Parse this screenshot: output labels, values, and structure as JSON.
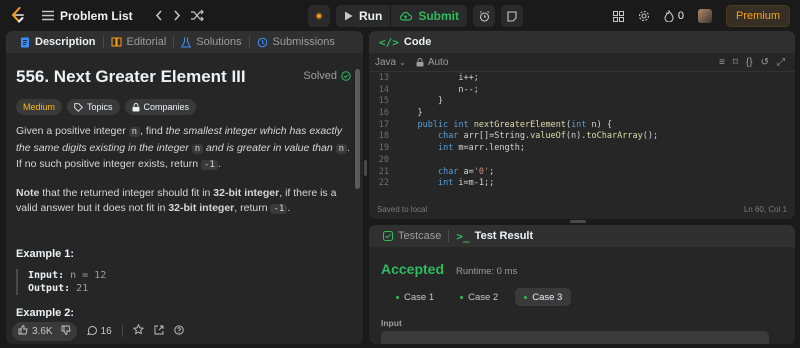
{
  "topbar": {
    "problem_list_label": "Problem List",
    "run_label": "Run",
    "submit_label": "Submit",
    "streak_count": "0",
    "premium_label": "Premium"
  },
  "left": {
    "tabs": [
      {
        "label": "Description"
      },
      {
        "label": "Editorial"
      },
      {
        "label": "Solutions"
      },
      {
        "label": "Submissions"
      }
    ],
    "title": "556. Next Greater Element III",
    "status": "Solved",
    "badges": {
      "difficulty": "Medium",
      "topics": "Topics",
      "companies": "Companies"
    },
    "para1": {
      "a": "Given a positive integer ",
      "code1": "n",
      "b": ", find ",
      "c": "the smallest integer which has exactly the same digits existing in the integer ",
      "code2": "n",
      "d": " and is greater in value than ",
      "code3": "n",
      "e": ". If no such positive integer exists, return ",
      "code4": "-1",
      "f": "."
    },
    "para2": {
      "a": "Note",
      "b": " that the returned integer should fit in ",
      "c": "32-bit integer",
      "d": ", if there is a valid answer but it does not fit in ",
      "e": "32-bit integer",
      "f": ", return ",
      "code": "-1",
      "g": "."
    },
    "example1": {
      "title": "Example 1:",
      "input_label": "Input:",
      "input_value": " n = 12",
      "output_label": "Output:",
      "output_value": " 21"
    },
    "example2_title": "Example 2:",
    "footer": {
      "likes": "3.6K",
      "comments": "16"
    }
  },
  "code": {
    "header_label": "Code",
    "language": "Java",
    "mode": "Auto",
    "lines": [
      {
        "n": "13",
        "t": "            i++;"
      },
      {
        "n": "14",
        "t": "            n--;"
      },
      {
        "n": "15",
        "t": "        }"
      },
      {
        "n": "16",
        "t": "    }"
      },
      {
        "n": "17",
        "t": "    public int nextGreaterElement(int n) {"
      },
      {
        "n": "18",
        "t": "        char arr[]=String.valueOf(n).toCharArray();"
      },
      {
        "n": "19",
        "t": "        int m=arr.length;"
      },
      {
        "n": "20",
        "t": ""
      },
      {
        "n": "21",
        "t": "        char a='0';"
      },
      {
        "n": "22",
        "t": "        int i=m-1;;"
      }
    ],
    "saved_text": "Saved to local",
    "cursor_text": "Ln 60, Col 1"
  },
  "test": {
    "tab_testcase": "Testcase",
    "tab_result": "Test Result",
    "verdict": "Accepted",
    "runtime": "Runtime: 0 ms",
    "cases": [
      "Case 1",
      "Case 2",
      "Case 3"
    ],
    "input_label": "Input"
  },
  "colors": {
    "accent_green": "#2cbb5d",
    "premium_orange": "#ffa116",
    "medium_yellow": "#ffb800"
  }
}
